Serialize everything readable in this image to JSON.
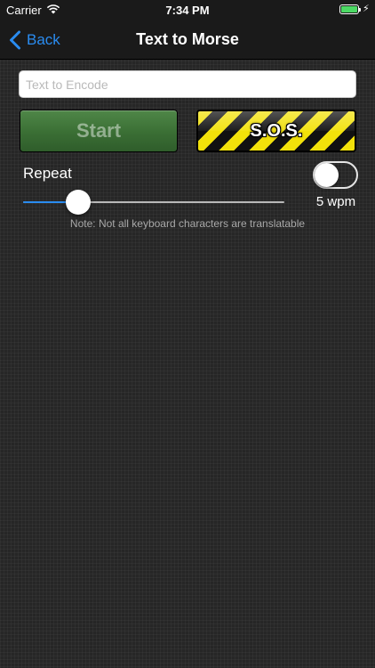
{
  "status_bar": {
    "carrier": "Carrier",
    "time": "7:34 PM",
    "charging_symbol": "⚡",
    "battery_level": 1.0
  },
  "nav": {
    "back_label": "Back",
    "title": "Text to Morse"
  },
  "encode_field": {
    "value": "",
    "placeholder": "Text to Encode"
  },
  "buttons": {
    "start_label": "Start",
    "sos_label": "S.O.S."
  },
  "repeat": {
    "label": "Repeat",
    "enabled": false
  },
  "speed": {
    "value_fraction": 0.13,
    "display": "5 wpm"
  },
  "note": "Note: Not all keyboard characters are translatable",
  "colors": {
    "accent": "#2a8cf0",
    "start_green": "#3a6e34",
    "hazard_yellow": "#f2e10a",
    "battery_green": "#4cd964"
  }
}
